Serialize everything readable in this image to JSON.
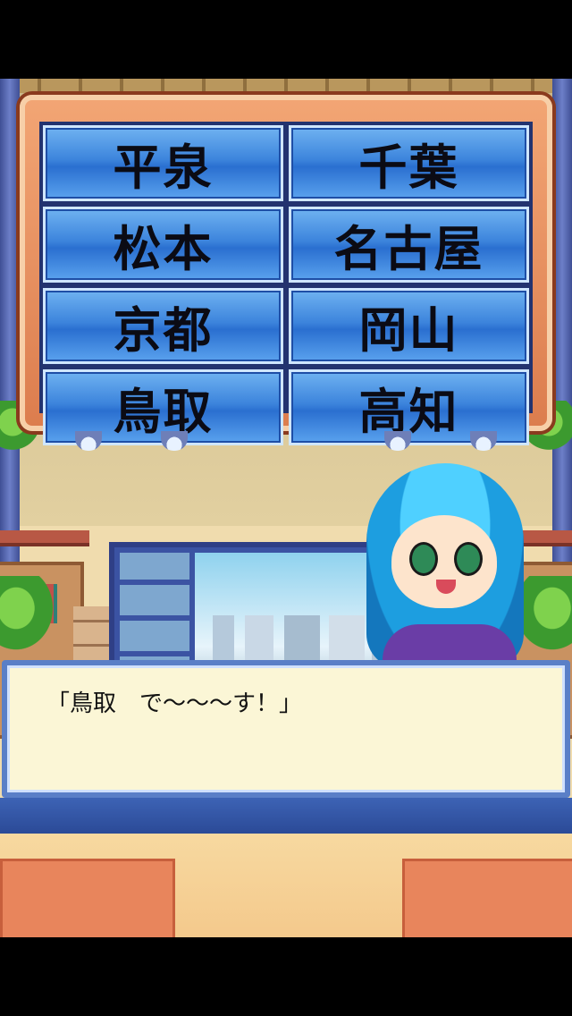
{
  "quiz": {
    "options": [
      "平泉",
      "千葉",
      "松本",
      "名古屋",
      "京都",
      "岡山",
      "鳥取",
      "高知"
    ]
  },
  "dialog": {
    "text": "「鳥取　で～～～す！」"
  }
}
